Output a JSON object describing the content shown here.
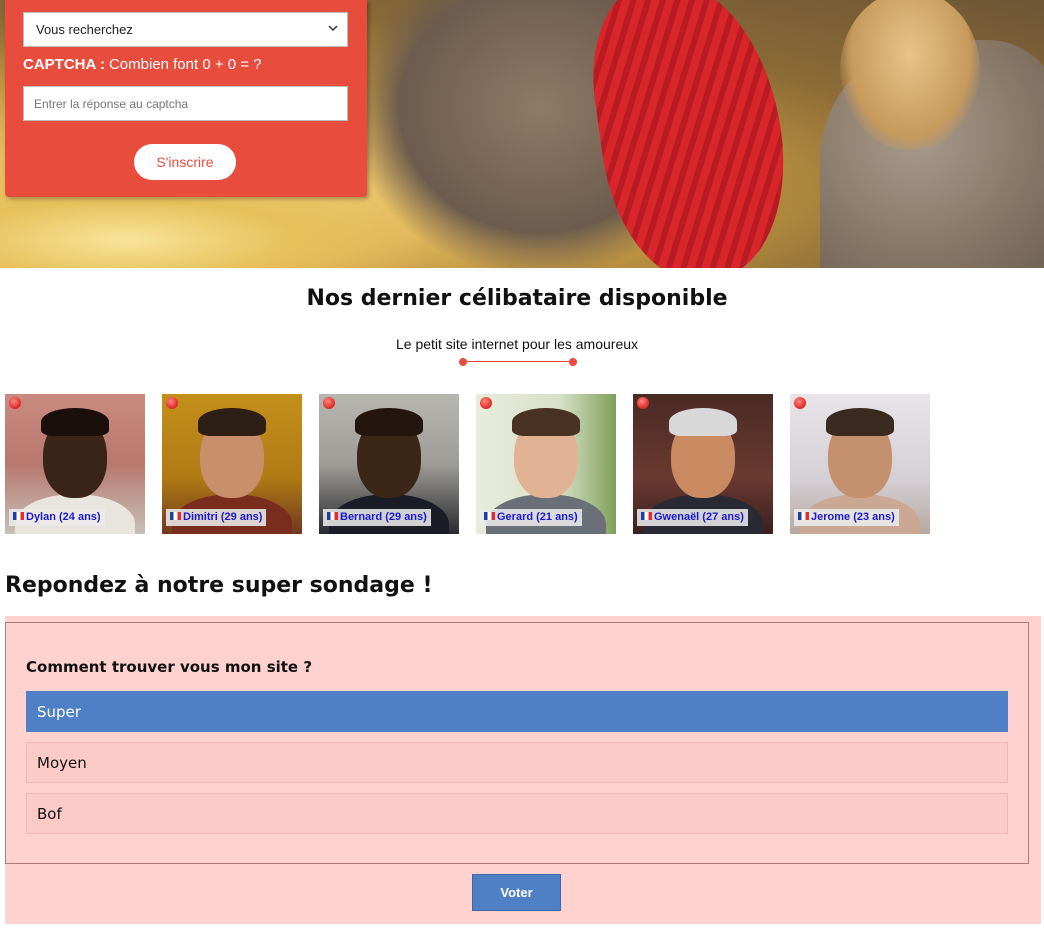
{
  "signup": {
    "search_select": "Vous recherchez",
    "captcha_label_bold": "CAPTCHA :",
    "captcha_question": "Combien font 0 + 0 = ?",
    "captcha_placeholder": "Entrer la réponse au captcha",
    "submit_label": "S'inscrire"
  },
  "singles": {
    "title": "Nos dernier célibataire disponible",
    "subtitle": "Le petit site internet pour les amoureux",
    "profiles": [
      {
        "label": "Dylan (24 ans)"
      },
      {
        "label": "Dimitri (29 ans)"
      },
      {
        "label": "Bernard (29 ans)"
      },
      {
        "label": "Gerard (21 ans)"
      },
      {
        "label": "Gwenaël (27 ans)"
      },
      {
        "label": "Jerome (23 ans)"
      }
    ]
  },
  "poll": {
    "title": "Repondez à notre super sondage !",
    "question": "Comment trouver vous mon site ?",
    "options": [
      "Super",
      "Moyen",
      "Bof"
    ],
    "selected": "Super",
    "vote_label": "Voter"
  },
  "colors": {
    "brand_red": "#e84c3d",
    "poll_bg": "#ffd1cf",
    "selected_blue": "#4f80c6"
  },
  "icons": {
    "select": "chevron-down-icon",
    "online": "online-status-icon",
    "flag": "france-flag-icon",
    "divider": "heart-divider-icon"
  }
}
